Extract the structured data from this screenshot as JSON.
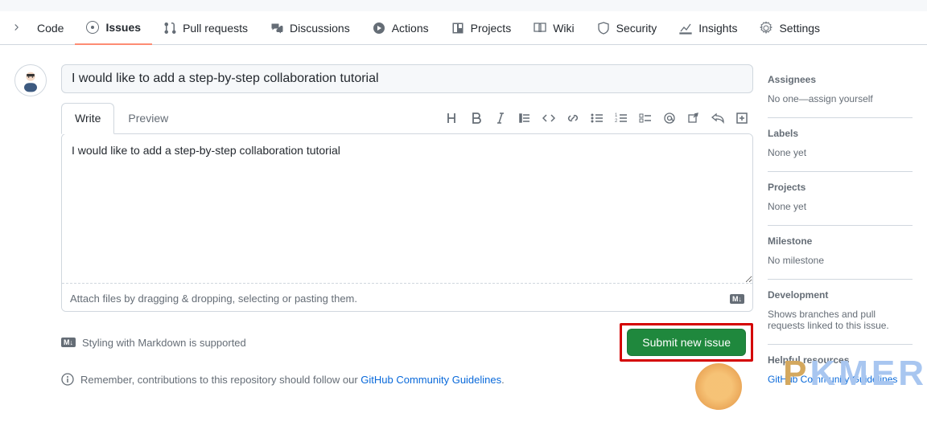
{
  "nav": {
    "code": "Code",
    "issues": "Issues",
    "pulls": "Pull requests",
    "discussions": "Discussions",
    "actions": "Actions",
    "projects": "Projects",
    "wiki": "Wiki",
    "security": "Security",
    "insights": "Insights",
    "settings": "Settings"
  },
  "form": {
    "title_value": "I would like to add a step-by-step collaboration tutorial",
    "tab_write": "Write",
    "tab_preview": "Preview",
    "body_value": "I would like to add a step-by-step collaboration tutorial",
    "attach_hint": "Attach files by dragging & dropping, selecting or pasting them.",
    "md_note": "Styling with Markdown is supported",
    "submit_label": "Submit new issue",
    "contrib_prefix": "Remember, contributions to this repository should follow our ",
    "contrib_link": "GitHub Community Guidelines",
    "contrib_suffix": "."
  },
  "sidebar": {
    "assignees": {
      "title": "Assignees",
      "content": "No one—",
      "link": "assign yourself"
    },
    "labels": {
      "title": "Labels",
      "content": "None yet"
    },
    "projects": {
      "title": "Projects",
      "content": "None yet"
    },
    "milestone": {
      "title": "Milestone",
      "content": "No milestone"
    },
    "development": {
      "title": "Development",
      "content": "Shows branches and pull requests linked to this issue."
    },
    "helpful": {
      "title": "Helpful resources",
      "link": "GitHub Community Guidelines"
    }
  }
}
